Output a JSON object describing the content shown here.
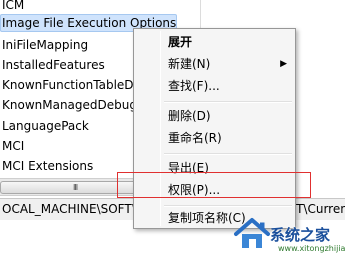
{
  "tree": {
    "items": [
      {
        "label": "ICM"
      },
      {
        "label": "Image File Execution Options",
        "selected": true
      },
      {
        "label": "IniFileMapping"
      },
      {
        "label": "InstalledFeatures"
      },
      {
        "label": "KnownFunctionTableDlls"
      },
      {
        "label": "KnownManagedDebuggingDlls"
      },
      {
        "label": "LanguagePack"
      },
      {
        "label": "MCI"
      },
      {
        "label": "MCI Extensions"
      }
    ]
  },
  "scrollbar": {
    "grip": "III",
    "arrow": "▶"
  },
  "statusbar": {
    "path": "OCAL_MACHINE\\SOFTWARE\\Microsoft\\Windows NT\\CurrentVersion\\Image File Execution Options"
  },
  "context_menu": {
    "expand": "展开",
    "new": "新建(N)",
    "new_arrow": "▶",
    "find": "查找(F)...",
    "delete": "删除(D)",
    "rename": "重命名(R)",
    "export": "导出(E)",
    "permissions": "权限(P)...",
    "copy_key_name": "复制项名称(C)"
  },
  "colors": {
    "highlight_box": "#e03030",
    "selection": "#cfe3fc"
  },
  "watermark": {
    "text": "系统之家",
    "url": "www.xitongzhijia.net"
  }
}
